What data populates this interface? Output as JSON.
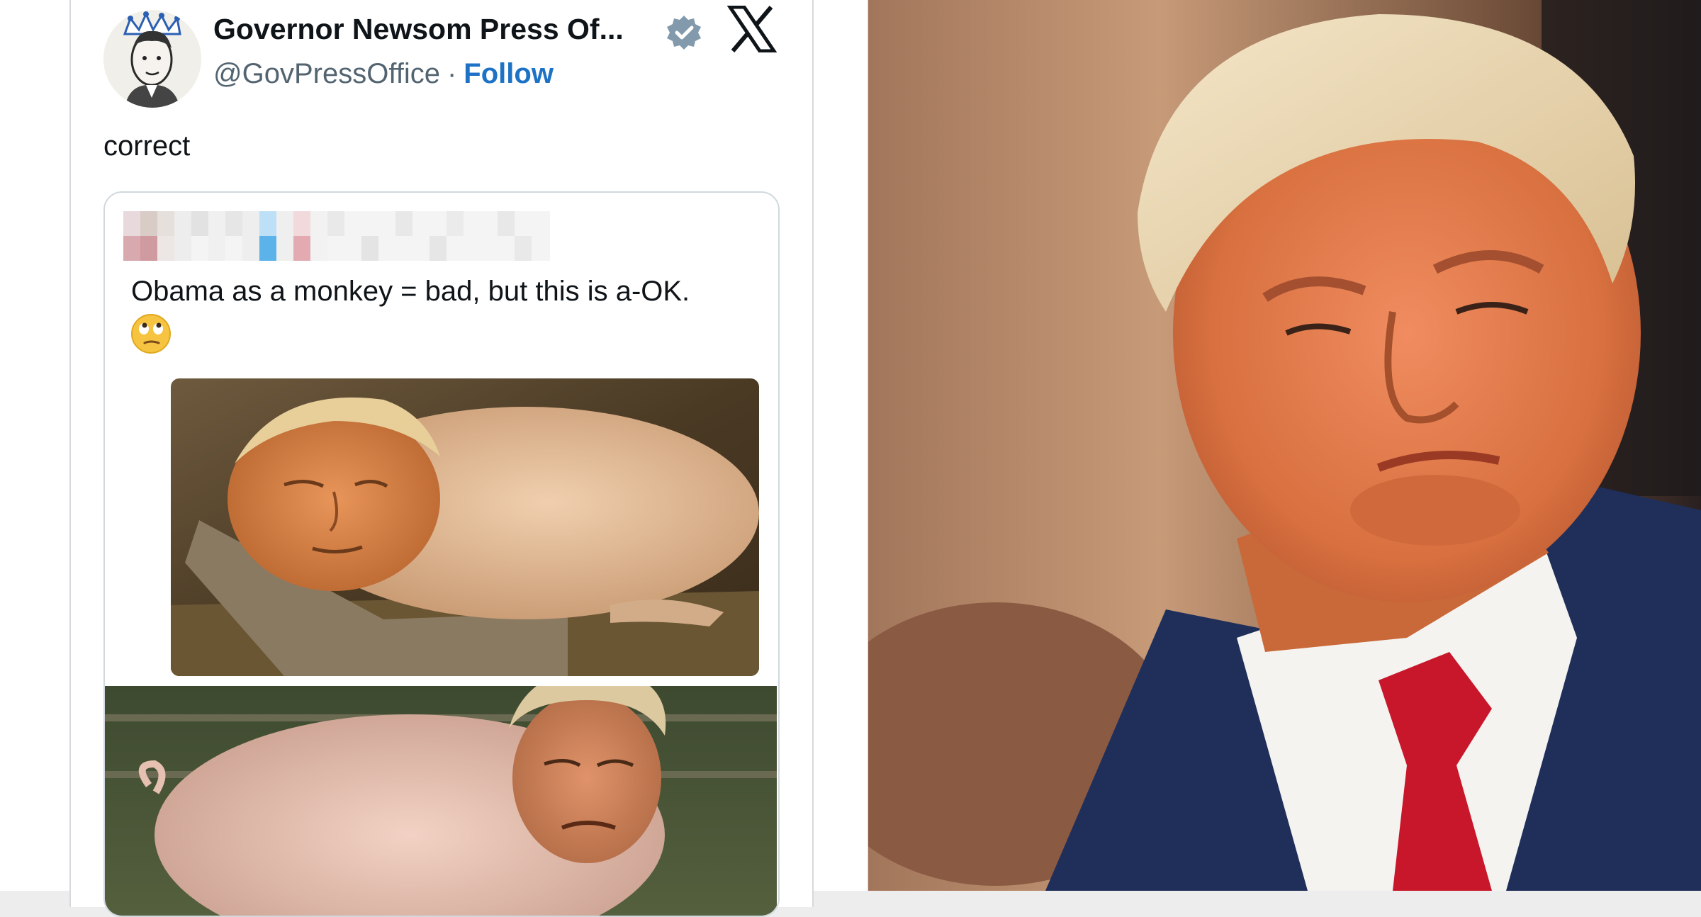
{
  "tweet": {
    "display_name": "Governor Newsom Press Of...",
    "handle": "@GovPressOffice",
    "separator": "·",
    "follow_label": "Follow",
    "text": "correct"
  },
  "quoted_tweet": {
    "text": "Obama as a monkey = bad, but this is a-OK.",
    "emoji": "face-with-rolling-eyes"
  },
  "colors": {
    "follow_link": "#1d72c6",
    "verified_badge": "#829aab",
    "card_border": "#cfd9de"
  }
}
